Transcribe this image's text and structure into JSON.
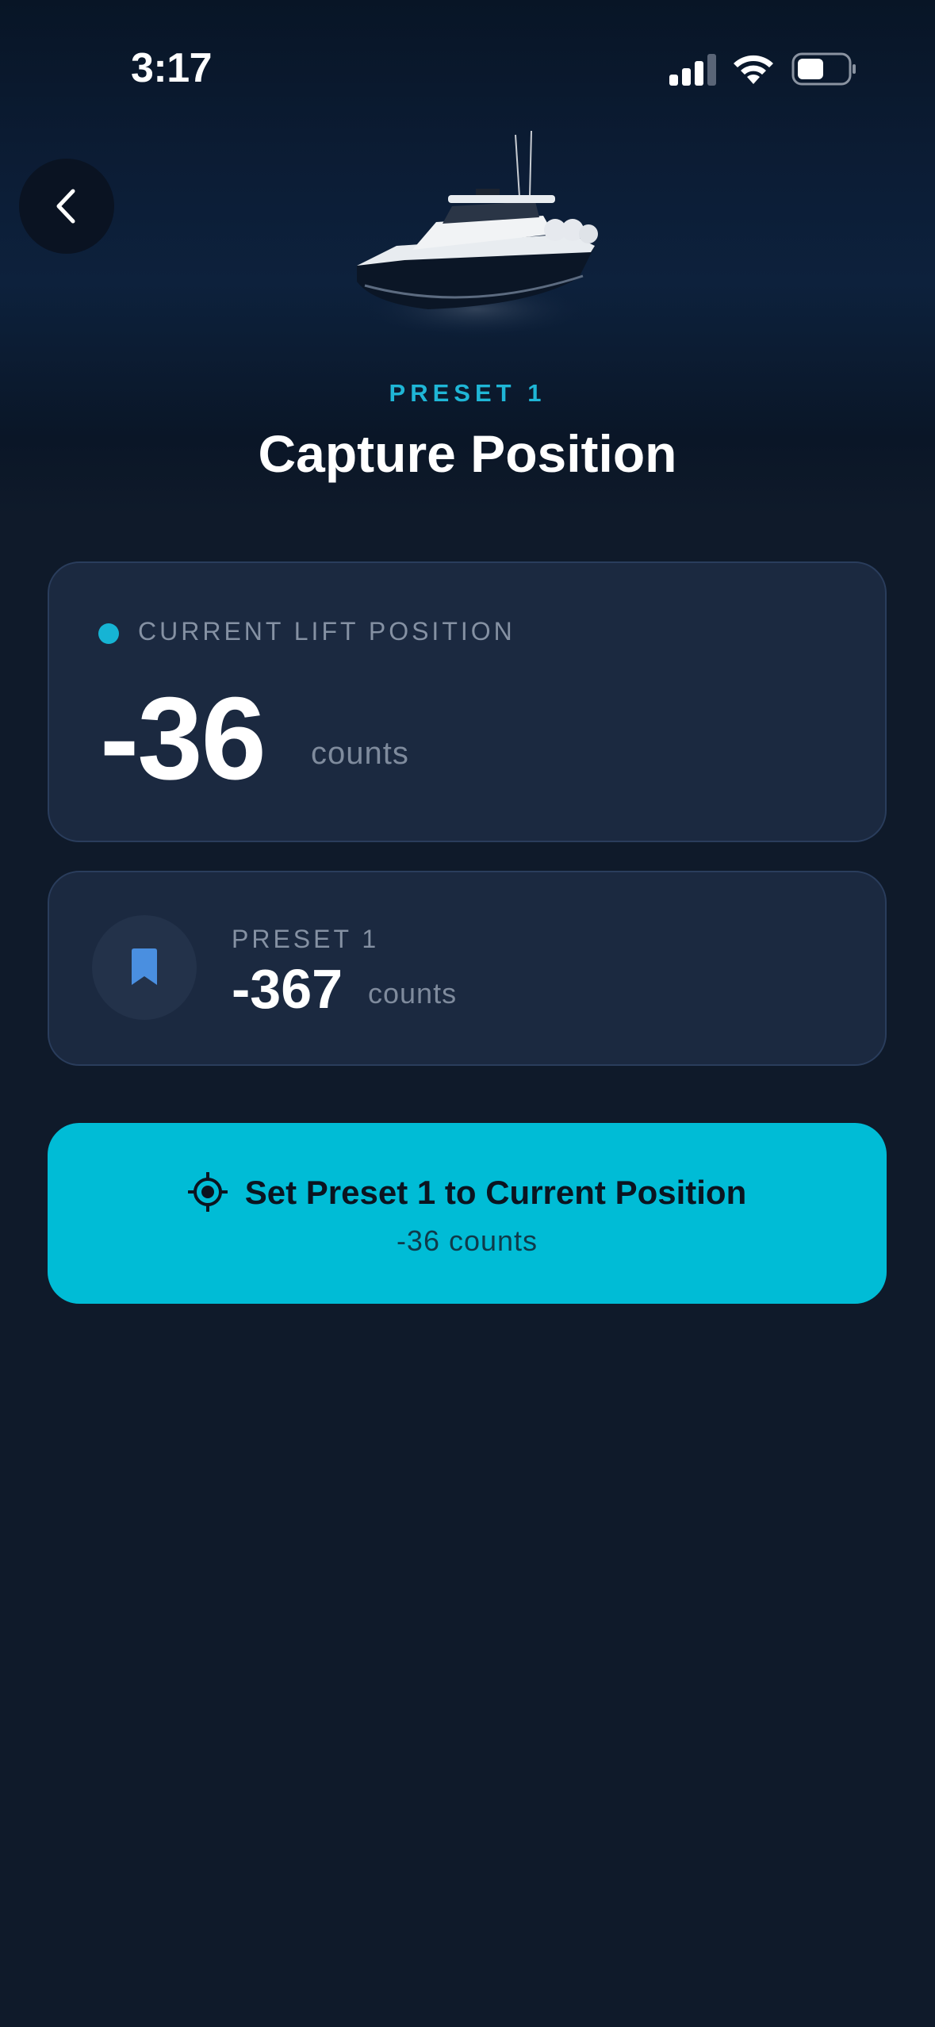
{
  "status_bar": {
    "time": "3:17"
  },
  "header": {
    "preset_label": "PRESET 1",
    "title": "Capture Position"
  },
  "current_position": {
    "label": "CURRENT LIFT POSITION",
    "value": "-36",
    "unit": "counts",
    "indicator_color": "#16b4d4"
  },
  "preset": {
    "label": "PRESET 1",
    "value": "-367",
    "unit": "counts",
    "icon": "bookmark-icon"
  },
  "action": {
    "label": "Set Preset 1 to Current Position",
    "sublabel": "-36 counts",
    "icon": "target-icon",
    "color": "#00bcd6"
  }
}
